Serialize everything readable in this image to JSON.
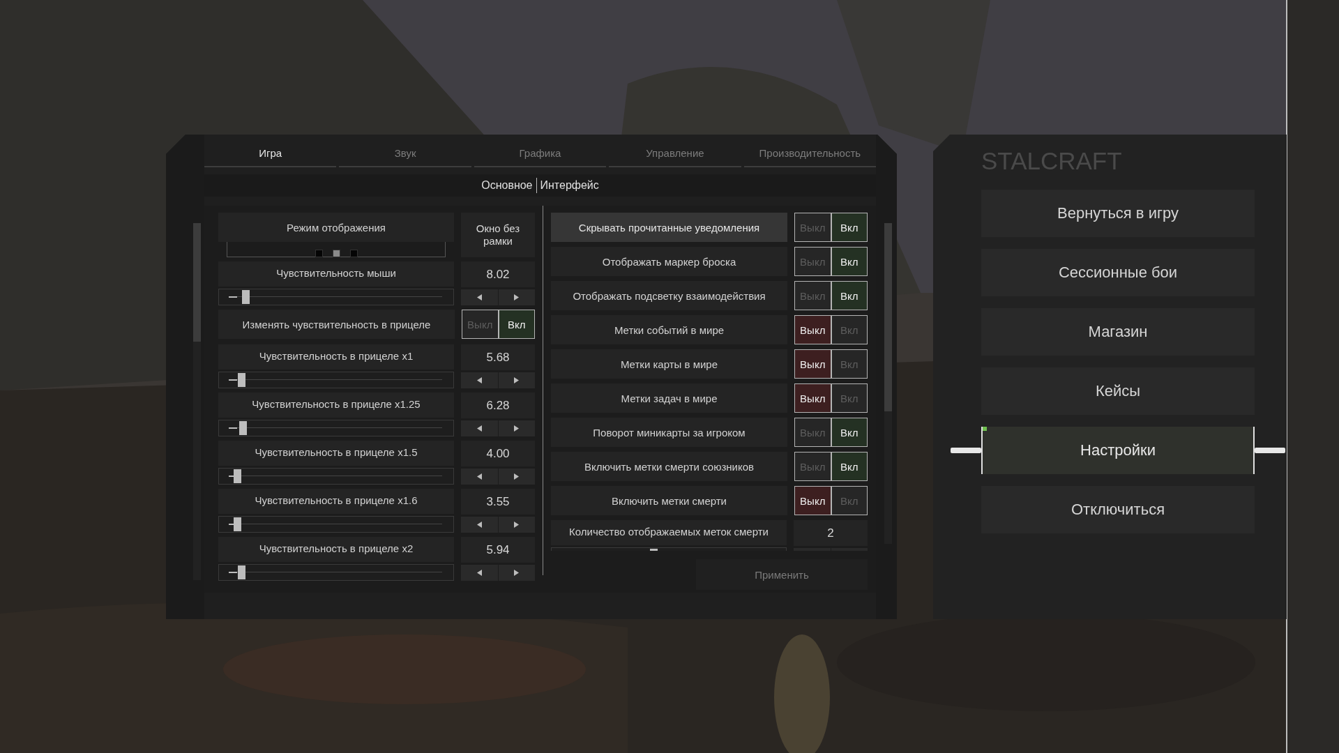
{
  "tabs": [
    {
      "label": "Игра",
      "selected": true
    },
    {
      "label": "Звук",
      "selected": false
    },
    {
      "label": "Графика",
      "selected": false
    },
    {
      "label": "Управление",
      "selected": false
    },
    {
      "label": "Производительность",
      "selected": false
    }
  ],
  "subtabs": [
    "Основное",
    "Интерфейс"
  ],
  "left_rows": [
    {
      "kind": "mode",
      "label": "Режим отображения",
      "value": "Окно без рамки",
      "level": 0.5
    },
    {
      "kind": "slider",
      "label": "Чувствительность мыши",
      "value": "8.02",
      "level": 0.08
    },
    {
      "kind": "toggle",
      "label": "Изменять чувствительность в прицеле",
      "off_label": "Выкл",
      "on_label": "Вкл",
      "on": true,
      "highlighted": false
    },
    {
      "kind": "slider",
      "label": "Чувствительность в прицеле x1",
      "value": "5.68",
      "level": 0.06
    },
    {
      "kind": "slider",
      "label": "Чувствительность в прицеле x1.25",
      "value": "6.28",
      "level": 0.065
    },
    {
      "kind": "slider",
      "label": "Чувствительность в прицеле x1.5",
      "value": "4.00",
      "level": 0.04
    },
    {
      "kind": "slider",
      "label": "Чувствительность в прицеле x1.6",
      "value": "3.55",
      "level": 0.04
    },
    {
      "kind": "slider",
      "label": "Чувствительность в прицеле x2",
      "value": "5.94",
      "level": 0.06
    }
  ],
  "right_rows": [
    {
      "kind": "toggle",
      "label": "Скрывать прочитанные уведомления",
      "off_label": "Выкл",
      "on_label": "Вкл",
      "on": true,
      "highlighted": true
    },
    {
      "kind": "toggle",
      "label": "Отображать маркер броска",
      "off_label": "Выкл",
      "on_label": "Вкл",
      "on": true,
      "highlighted": false
    },
    {
      "kind": "toggle",
      "label": "Отображать подсветку взаимодействия",
      "off_label": "Выкл",
      "on_label": "Вкл",
      "on": true,
      "highlighted": false
    },
    {
      "kind": "toggle",
      "label": "Метки событий в мире",
      "off_label": "Выкл",
      "on_label": "Вкл",
      "on": false,
      "highlighted": false
    },
    {
      "kind": "toggle",
      "label": "Метки карты в мире",
      "off_label": "Выкл",
      "on_label": "Вкл",
      "on": false,
      "highlighted": false
    },
    {
      "kind": "toggle",
      "label": "Метки задач в мире",
      "off_label": "Выкл",
      "on_label": "Вкл",
      "on": false,
      "highlighted": false
    },
    {
      "kind": "toggle",
      "label": "Поворот миникарты за игроком",
      "off_label": "Выкл",
      "on_label": "Вкл",
      "on": true,
      "highlighted": false
    },
    {
      "kind": "toggle",
      "label": "Включить метки смерти союзников",
      "off_label": "Выкл",
      "on_label": "Вкл",
      "on": true,
      "highlighted": false
    },
    {
      "kind": "toggle",
      "label": "Включить метки смерти",
      "off_label": "Выкл",
      "on_label": "Вкл",
      "on": false,
      "highlighted": false
    },
    {
      "kind": "slider",
      "label": "Количество отображаемых меток смерти",
      "value": "2",
      "level": 0.43
    }
  ],
  "apply_button": "Применить",
  "menu": {
    "title": "STALCRAFT",
    "items": [
      {
        "label": "Вернуться в игру",
        "selected": false
      },
      {
        "label": "Сессионные бои",
        "selected": false
      },
      {
        "label": "Магазин",
        "selected": false
      },
      {
        "label": "Кейсы",
        "selected": false
      },
      {
        "label": "Настройки",
        "selected": true
      },
      {
        "label": "Отключиться",
        "selected": false
      }
    ]
  }
}
